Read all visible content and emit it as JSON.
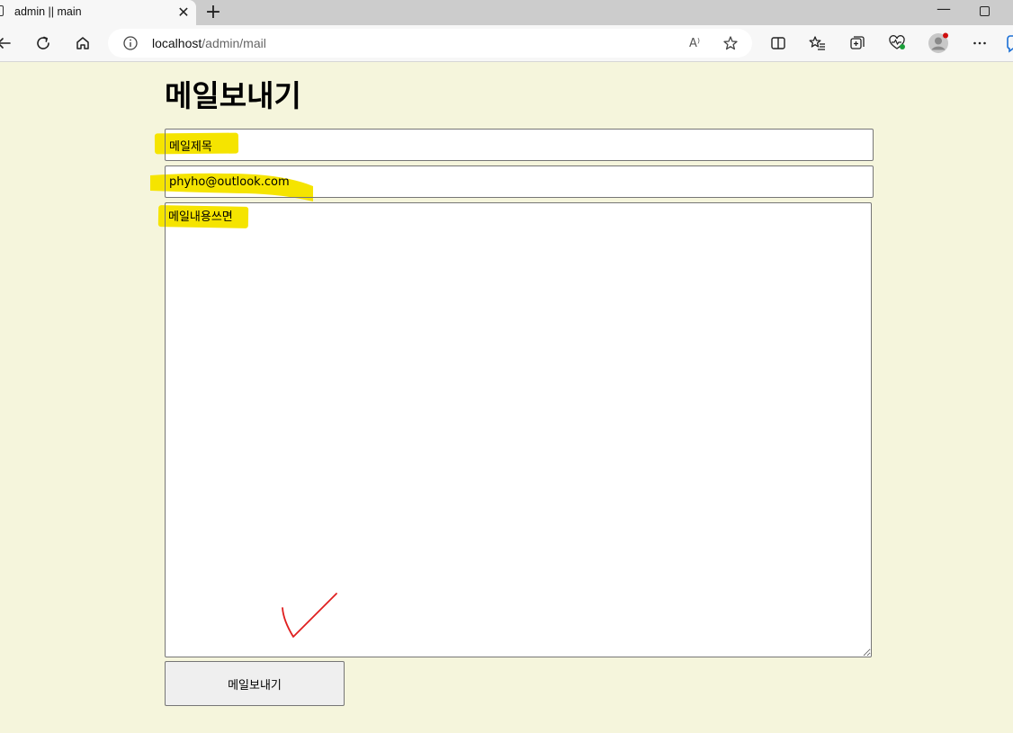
{
  "browser": {
    "tab_title": "admin || main",
    "close_tab_glyph": "✕",
    "new_tab_glyph": "+",
    "url_host": "localhost",
    "url_path": "/admin/mail",
    "read_aloud_glyph": "A⁾",
    "minimize_glyph": "—",
    "icons": [
      "back-icon",
      "refresh-icon",
      "home-icon",
      "site-info-icon",
      "read-aloud-icon",
      "favorite-star-icon",
      "split-screen-icon",
      "favorites-icon",
      "collections-icon",
      "browser-essentials-icon",
      "profile-avatar-icon",
      "more-options-icon",
      "copilot-icon"
    ]
  },
  "page": {
    "title": "메일보내기",
    "subject_value": "메일제목",
    "to_value": "phyho@outlook.com",
    "body_value": "메일내용쓰면",
    "send_label": "메일보내기"
  },
  "colors": {
    "page_background": "#f5f5dc",
    "highlight": "#f5e400",
    "annotation_check": "#e02020"
  }
}
